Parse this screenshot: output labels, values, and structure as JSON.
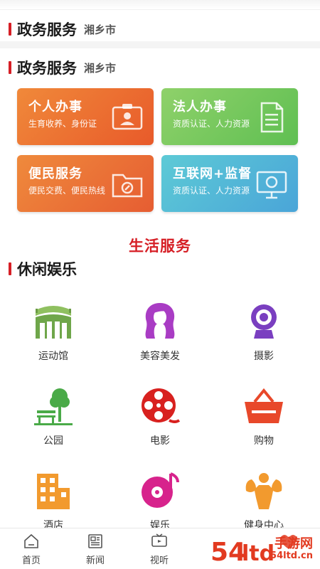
{
  "gov_header_top": {
    "title": "政务服务",
    "city": "湘乡市"
  },
  "gov_header": {
    "title": "政务服务",
    "city": "湘乡市"
  },
  "cards": {
    "personal": {
      "title": "个人办事",
      "subtitle": "生育收养、身份证"
    },
    "legal": {
      "title": "法人办事",
      "subtitle": "资质认证、人力资源"
    },
    "civic": {
      "title": "便民服务",
      "subtitle": "便民交费、便民热线"
    },
    "internet": {
      "title": "互联网+监督",
      "subtitle": "资质认证、人力资源"
    }
  },
  "life_services": {
    "title": "生活服务"
  },
  "leisure": {
    "title": "休闲娱乐",
    "items": [
      {
        "label": "运动馆",
        "icon": "stadium-icon"
      },
      {
        "label": "美容美发",
        "icon": "beauty-icon"
      },
      {
        "label": "摄影",
        "icon": "camera-icon"
      },
      {
        "label": "公园",
        "icon": "park-icon"
      },
      {
        "label": "电影",
        "icon": "film-reel-icon"
      },
      {
        "label": "购物",
        "icon": "shopping-basket-icon"
      },
      {
        "label": "酒店",
        "icon": "hotel-icon"
      },
      {
        "label": "娱乐",
        "icon": "music-disc-icon"
      },
      {
        "label": "健身中心",
        "icon": "fitness-icon"
      }
    ]
  },
  "tabbar": {
    "tabs": [
      {
        "label": "首页",
        "icon": "home-icon"
      },
      {
        "label": "新闻",
        "icon": "news-icon"
      },
      {
        "label": "视听",
        "icon": "tv-icon"
      }
    ]
  },
  "watermark": {
    "text": "手游网",
    "brand": "54ltd",
    "url": "54ltd.cn"
  },
  "colors": {
    "accent": "#d61f26",
    "orange": "#e85a2a",
    "green": "#5fbf52",
    "teal": "#4aa5d8"
  }
}
